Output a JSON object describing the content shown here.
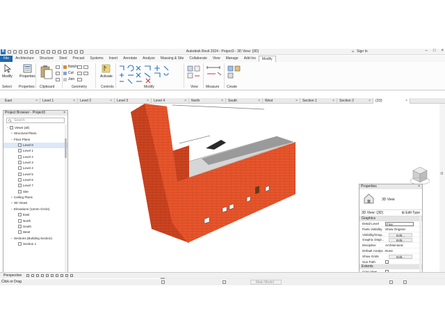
{
  "window": {
    "title": "Autodesk Revit 2024 - Project3 - 3D View: {3D}",
    "app_icon": "R",
    "sign_in": "Sign In"
  },
  "ribbon_tabs": [
    "File",
    "Architecture",
    "Structure",
    "Steel",
    "Precast",
    "Systems",
    "Insert",
    "Annotate",
    "Analyze",
    "Massing & Site",
    "Collaborate",
    "View",
    "Manage",
    "Add-Ins",
    "Modify"
  ],
  "ribbon": {
    "modify": "Modify",
    "properties": "Properties",
    "activate": "Activate",
    "small_tools": [
      "Notch",
      "Cut",
      "Join"
    ],
    "groups": {
      "select": "Select",
      "properties": "Properties",
      "clipboard": "Clipboard",
      "geometry": "Geometry",
      "controls": "Controls",
      "modify": "Modify",
      "view": "View",
      "measure": "Measure",
      "create": "Create"
    }
  },
  "view_tabs": [
    "East",
    "Level 1",
    "Level 2",
    "Level 3",
    "Level 4",
    "North",
    "South",
    "West",
    "Section 1",
    "Section 2",
    "{3D}"
  ],
  "project_browser": {
    "title": "Project Browser - Project3",
    "search_placeholder": "Search",
    "tree": [
      {
        "label": "Views (all)",
        "toggle": "−",
        "depth": 0,
        "icon": true
      },
      {
        "label": "Structural Plans",
        "toggle": "+",
        "depth": 1
      },
      {
        "label": "Floor Plans",
        "toggle": "−",
        "depth": 1
      },
      {
        "label": "Level 0",
        "depth": 2,
        "icon": true
      },
      {
        "label": "Level 1",
        "depth": 2,
        "icon": true
      },
      {
        "label": "Level 2",
        "depth": 2,
        "icon": true
      },
      {
        "label": "Level 3",
        "depth": 2,
        "icon": true
      },
      {
        "label": "Level 4",
        "depth": 2,
        "icon": true
      },
      {
        "label": "Level 5",
        "depth": 2,
        "icon": true
      },
      {
        "label": "Level 6",
        "depth": 2,
        "icon": true
      },
      {
        "label": "Level 7",
        "depth": 2,
        "icon": true
      },
      {
        "label": "Site",
        "depth": 2,
        "icon": true
      },
      {
        "label": "Ceiling Plans",
        "toggle": "+",
        "depth": 1
      },
      {
        "label": "3D Views",
        "toggle": "+",
        "depth": 1
      },
      {
        "label": "Elevations (12mm Circle)",
        "toggle": "−",
        "depth": 1
      },
      {
        "label": "East",
        "depth": 2,
        "icon": true
      },
      {
        "label": "North",
        "depth": 2,
        "icon": true
      },
      {
        "label": "South",
        "depth": 2,
        "icon": true
      },
      {
        "label": "West",
        "depth": 2,
        "icon": true
      },
      {
        "label": "Sections (Building Section)",
        "toggle": "−",
        "depth": 1
      },
      {
        "label": "Section 1",
        "depth": 2,
        "icon": true
      }
    ]
  },
  "properties": {
    "title": "Properties",
    "type_name": "3D View",
    "selector": "3D View: {3D}",
    "edit_type": "Edit Type",
    "graphics_header": "Graphics",
    "extents_header": "Extents",
    "rows": [
      {
        "k": "Detail Level",
        "v": "Fine",
        "style": "boxed"
      },
      {
        "k": "Parts Visibility",
        "v": "Show Original",
        "style": "plain"
      },
      {
        "k": "Visibility/Grap...",
        "v": "Edit...",
        "style": "btn"
      },
      {
        "k": "Graphic Displ...",
        "v": "Edit...",
        "style": "btn"
      },
      {
        "k": "Discipline",
        "v": "Architectural",
        "style": "plain"
      },
      {
        "k": "Default Analys...",
        "v": "None",
        "style": "plain"
      },
      {
        "k": "Show Grids",
        "v": "Edit...",
        "style": "btn"
      },
      {
        "k": "Sun Path",
        "v": "",
        "style": "check"
      }
    ],
    "extent_rows": [
      {
        "k": "Crop View",
        "v": "",
        "style": "check"
      },
      {
        "k": "Crop Region V...",
        "v": "",
        "style": "check"
      }
    ]
  },
  "status": {
    "view_mode": "Perspective",
    "hint": "Click or Drag",
    "model": "Main Model",
    "zoom_marker": ":0"
  },
  "colors": {
    "wall_front": "#e8552b",
    "wall_side": "#c93f1c",
    "brick_lines": "#9c2c12",
    "roof": "#cfcfcf",
    "accent": "#2166ab"
  }
}
